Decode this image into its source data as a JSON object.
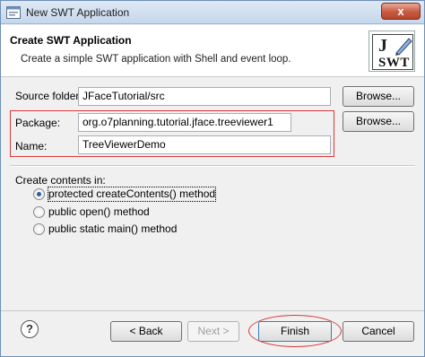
{
  "window": {
    "title": "New SWT Application",
    "close_label": "x",
    "app_icon": "eclipse-wizard-icon"
  },
  "header": {
    "title": "Create SWT Application",
    "description": "Create a simple SWT application with Shell and event loop.",
    "logo": {
      "letter": "J",
      "text": "SWT",
      "icon": "swt-logo-icon"
    }
  },
  "form": {
    "source_folder": {
      "label": "Source folder:",
      "value": "JFaceTutorial/src",
      "browse_label": "Browse..."
    },
    "package": {
      "label": "Package:",
      "value": "org.o7planning.tutorial.jface.treeviewer1",
      "browse_label": "Browse..."
    },
    "name": {
      "label": "Name:",
      "value": "TreeViewerDemo"
    }
  },
  "contents": {
    "label": "Create contents in:",
    "options": [
      {
        "label": "protected createContents() method",
        "checked": true
      },
      {
        "label": "public open() method",
        "checked": false
      },
      {
        "label": "public static main() method",
        "checked": false
      }
    ]
  },
  "footer": {
    "help_icon": "help-icon",
    "help_glyph": "?",
    "back_label": "< Back",
    "next_label": "Next >",
    "finish_label": "Finish",
    "cancel_label": "Cancel"
  },
  "colors": {
    "highlight_frame": "#d9383b",
    "title_gradient_top": "#dfe9f5",
    "title_gradient_bottom": "#c6d7ec"
  }
}
